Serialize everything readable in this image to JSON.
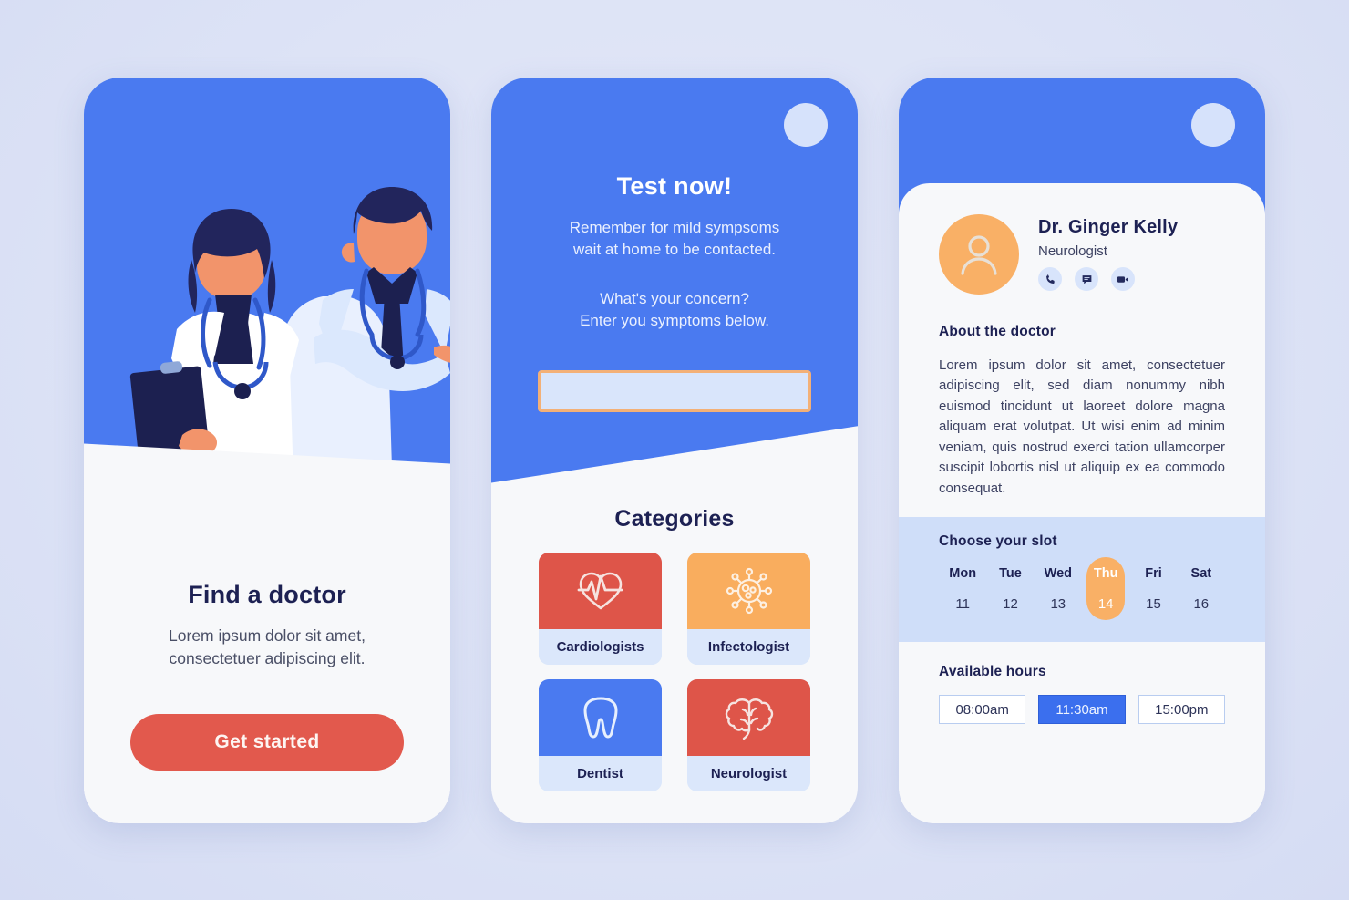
{
  "theme": {
    "blue": "#4a7af0",
    "red": "#e2594d",
    "orange": "#f9b066",
    "light_blue": "#cfdef9",
    "navy": "#1d2153",
    "page_bg": "#dde3f6"
  },
  "screen1": {
    "name": "find-a-doctor-onboarding",
    "illustration_alt": "two doctors illustration",
    "title": "Find a doctor",
    "subtitle": "Lorem ipsum dolor sit amet,\nconsectetuer adipiscing elit.",
    "subtitle_line1": "Lorem ipsum dolor sit amet,",
    "subtitle_line2": "consectetuer adipiscing elit.",
    "cta_label": "Get started"
  },
  "screen2": {
    "name": "symptom-test-screen",
    "avatar_icon": "circle-avatar-icon",
    "title": "Test now!",
    "note_line1": "Remember for mild sympsoms",
    "note_line2": "wait at home to be contacted.",
    "prompt_line1": "What's your concern?",
    "prompt_line2": "Enter you symptoms below.",
    "input": {
      "value": "",
      "placeholder": ""
    },
    "categories_title": "Categories",
    "categories": [
      {
        "label": "Cardiologists",
        "icon": "heart-pulse-icon",
        "color": "#de5549"
      },
      {
        "label": "Infectologist",
        "icon": "virus-icon",
        "color": "#f9ad5e"
      },
      {
        "label": "Dentist",
        "icon": "tooth-icon",
        "color": "#4a7af0"
      },
      {
        "label": "Neurologist",
        "icon": "brain-icon",
        "color": "#de5549"
      }
    ]
  },
  "screen3": {
    "name": "doctor-profile-booking",
    "avatar_icon": "circle-avatar-icon",
    "doctor": {
      "name": "Dr. Ginger Kelly",
      "specialty": "Neurologist",
      "avatar_icon": "person-avatar-icon",
      "contact_actions": [
        {
          "icon": "phone-icon",
          "name": "call"
        },
        {
          "icon": "chat-icon",
          "name": "message"
        },
        {
          "icon": "video-icon",
          "name": "video-call"
        }
      ]
    },
    "about_title": "About the doctor",
    "about_body": "Lorem ipsum dolor sit amet, consectetuer adipiscing elit, sed diam nonummy nibh euismod tincidunt ut laoreet dolore magna aliquam erat volutpat. Ut wisi enim ad minim veniam, quis nostrud exerci tation ullamcorper suscipit lobortis nisl ut aliquip ex ea commodo consequat.",
    "slot_title": "Choose your slot",
    "days": [
      {
        "name": "Mon",
        "num": "11",
        "selected": false
      },
      {
        "name": "Tue",
        "num": "12",
        "selected": false
      },
      {
        "name": "Wed",
        "num": "13",
        "selected": false
      },
      {
        "name": "Thu",
        "num": "14",
        "selected": true
      },
      {
        "name": "Fri",
        "num": "15",
        "selected": false
      },
      {
        "name": "Sat",
        "num": "16",
        "selected": false
      }
    ],
    "hours_title": "Available hours",
    "hours": [
      {
        "label": "08:00am",
        "selected": false
      },
      {
        "label": "11:30am",
        "selected": true
      },
      {
        "label": "15:00pm",
        "selected": false
      }
    ]
  }
}
